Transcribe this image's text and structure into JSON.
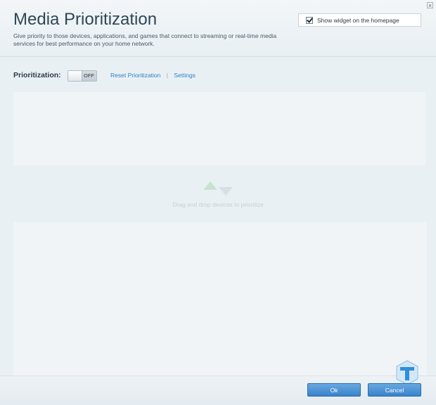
{
  "header": {
    "title": "Media Prioritization",
    "description": "Give priority to those devices, applications, and games that connect to streaming or real-time media services for best performance on your home network.",
    "widget_checkbox_label": "Show widget on the homepage",
    "widget_checked": true
  },
  "prioritization": {
    "label": "Prioritization:",
    "toggle_state": "OFF",
    "reset_link": "Reset Prioritization",
    "separator": "|",
    "settings_link": "Settings"
  },
  "dropzone": {
    "hint": "Drag and drop devices to prioritize",
    "icon": "up-down-arrows-icon"
  },
  "footer": {
    "ok_label": "Ok",
    "cancel_label": "Cancel"
  },
  "colors": {
    "accent": "#3a82c9",
    "link": "#2f7fc3",
    "title": "#2f4656"
  }
}
